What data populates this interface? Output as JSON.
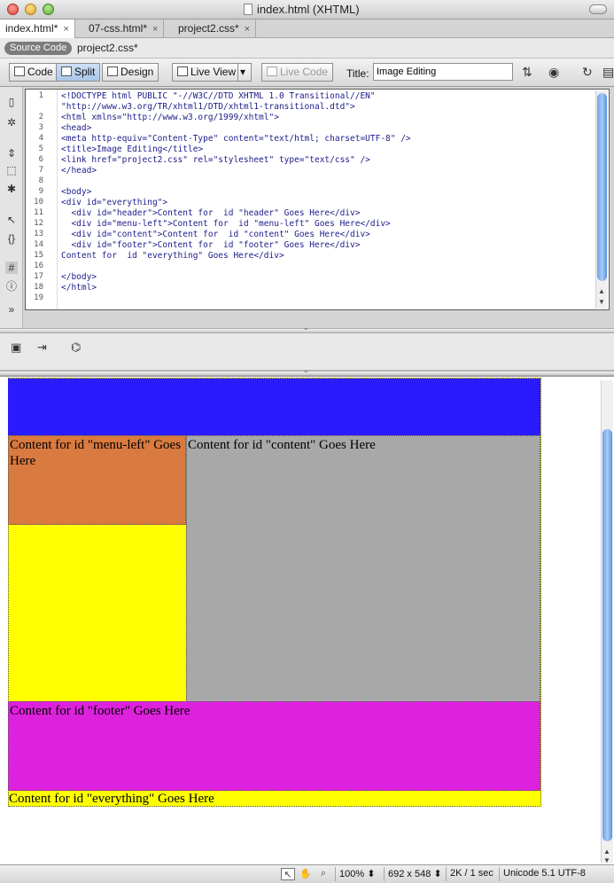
{
  "window": {
    "title": "index.html (XHTML)"
  },
  "doc_tabs": [
    {
      "label": "index.html*",
      "active": true
    },
    {
      "label": "07-css.html*",
      "active": false
    },
    {
      "label": "project2.css*",
      "active": false
    }
  ],
  "tab_close": "×",
  "related_files": {
    "source_code": "Source Code",
    "file": "project2.css*"
  },
  "toolbar": {
    "code": "Code",
    "split": "Split",
    "design": "Design",
    "live_view": "Live View",
    "live_code": "Live Code",
    "title_label": "Title:",
    "title_value": "Image Editing"
  },
  "code": {
    "line_numbers": [
      "1",
      "",
      "2",
      "3",
      "4",
      "5",
      "6",
      "7",
      "8",
      "9",
      "10",
      "11",
      "12",
      "13",
      "14",
      "15",
      "16",
      "17",
      "18",
      "19"
    ],
    "lines": [
      "<!DOCTYPE html PUBLIC \"-//W3C//DTD XHTML 1.0 Transitional//EN\"",
      "\"http://www.w3.org/TR/xhtml1/DTD/xhtml1-transitional.dtd\">",
      "<html xmlns=\"http://www.w3.org/1999/xhtml\">",
      "<head>",
      "<meta http-equiv=\"Content-Type\" content=\"text/html; charset=UTF-8\" />",
      "<title>Image Editing</title>",
      "<link href=\"project2.css\" rel=\"stylesheet\" type=\"text/css\" />",
      "</head>",
      "",
      "<body>",
      "<div id=\"everything\">",
      "  <div id=\"header\">Content for  id \"header\" Goes Here</div>",
      "  <div id=\"menu-left\">Content for  id \"menu-left\" Goes Here</div>",
      "  <div id=\"content\">Content for  id \"content\" Goes Here</div>",
      "  <div id=\"footer\">Content for  id \"footer\" Goes Here</div>",
      "Content for  id \"everything\" Goes Here</div>",
      "",
      "</body>",
      "</html>",
      ""
    ]
  },
  "design_view": {
    "menu_left": "Content for id \"menu-left\" Goes Here",
    "content": "Content for id \"content\" Goes Here",
    "footer": "Content for id \"footer\" Goes Here",
    "everything": "Content for id \"everything\" Goes Here",
    "colors": {
      "header": "#2a1bff",
      "menu_left": "#d97a40",
      "content": "#a8a8a8",
      "footer": "#dd22dd",
      "everything": "#ffff00"
    }
  },
  "status": {
    "zoom": "100%",
    "dimensions": "692 x 548",
    "download": "2K / 1 sec",
    "encoding": "Unicode 5.1 UTF-8"
  }
}
